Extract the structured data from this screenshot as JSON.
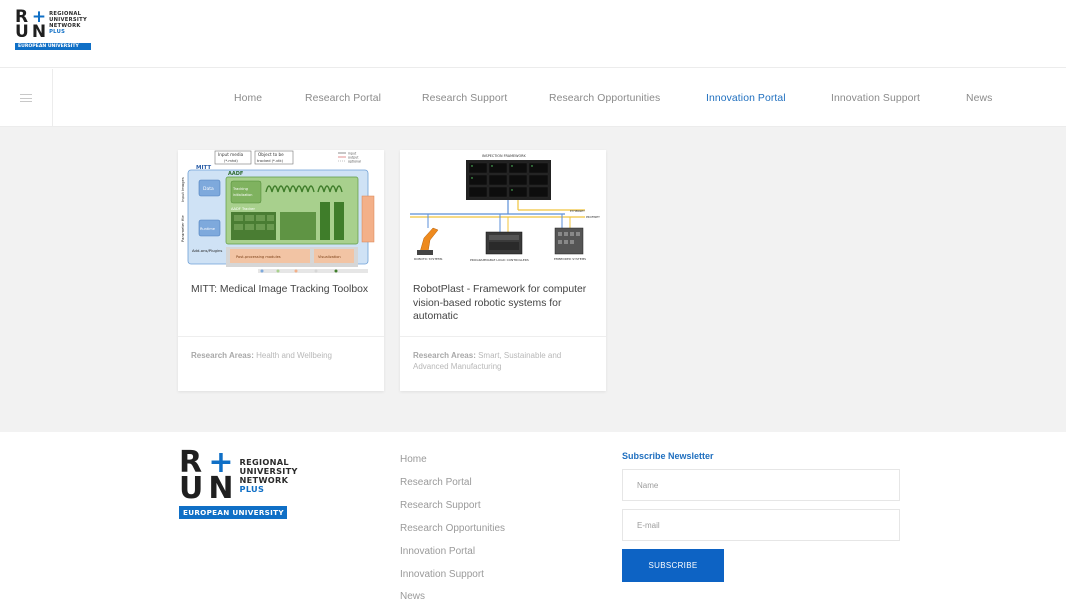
{
  "logo": {
    "letters": [
      "R",
      "+",
      "U",
      "N"
    ],
    "line1": "REGIONAL",
    "line2": "UNIVERSITY",
    "line3": "NETWORK",
    "line4": "PLUS",
    "badge": "EUROPEAN UNIVERSITY",
    "brand_color": "#0f6fc6"
  },
  "nav": {
    "menu_icon": "hamburger-icon",
    "items": [
      {
        "label": "Home"
      },
      {
        "label": "Research Portal"
      },
      {
        "label": "Research Support"
      },
      {
        "label": "Research Opportunities"
      },
      {
        "label": "Innovation Portal",
        "active": true
      },
      {
        "label": "Innovation Support"
      },
      {
        "label": "News"
      }
    ],
    "active_color": "#1f6fbf"
  },
  "cards": [
    {
      "title": "MITT: Medical Image Tracking Toolbox",
      "areas_label": "Research Areas:",
      "areas_value": "Health and Wellbeing",
      "diagram": {
        "label_input_media": "Input media",
        "label_input_media_fmt": "(*.mhd)",
        "label_object": "Object to be",
        "label_object2": "tracked (*.vtk)",
        "label_mitt": "MITT",
        "label_aadf": "AADF",
        "label_data": "Data",
        "label_tracking": "Tracking",
        "label_initialization": "initialization",
        "label_runtime": "Runtime",
        "label_aadf_tracker": "AADF Tracker",
        "label_addons": "Add-ons/Plugins",
        "label_postproc": "Post-processing modules",
        "label_visualization": "Visualization",
        "label_input_images": "Input images",
        "label_param_file": "Parameter file",
        "legend": [
          "input",
          "output",
          "optional"
        ]
      }
    },
    {
      "title": "RobotPlast - Framework for computer vision-based robotic systems for automatic",
      "areas_label": "Research Areas:",
      "areas_value": "Smart, Sustainable and Advanced Manufacturing",
      "diagram": {
        "label_top": "INSPECTION FRAMEWORK",
        "label_ethernet": "ETHERNET",
        "label_profinet": "PROFINET",
        "label_robotic": "ROBOTIC SYSTEMS",
        "label_plc": "PROGRAMMABLE LOGIC CONTROLLERS",
        "label_embedded": "EMBEDDED SYSTEMS"
      }
    }
  ],
  "footer": {
    "links": [
      {
        "label": "Home"
      },
      {
        "label": "Research Portal"
      },
      {
        "label": "Research Support"
      },
      {
        "label": "Research Opportunities"
      },
      {
        "label": "Innovation Portal"
      },
      {
        "label": "Innovation Support"
      },
      {
        "label": "News"
      }
    ],
    "newsletter": {
      "heading": "Subscribe Newsletter",
      "name_placeholder": "Name",
      "email_placeholder": "E-mail",
      "button": "SUBSCRIBE"
    }
  }
}
